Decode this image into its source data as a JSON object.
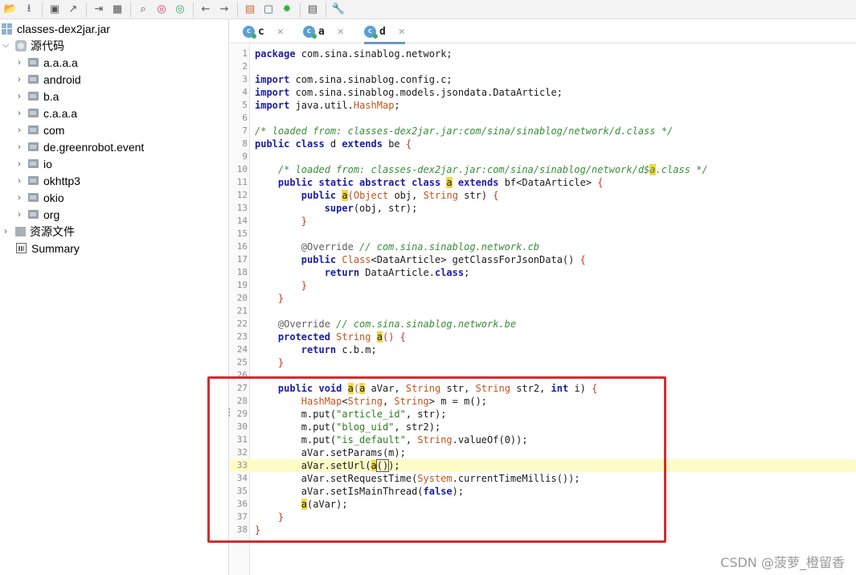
{
  "toolbar": {
    "icons": [
      "open-folder-icon",
      "export-icon",
      "save-icon",
      "external-link-icon",
      "step-icon",
      "decompile-icon",
      "search-icon",
      "find-class-icon",
      "find-usage-icon",
      "back-arrow-icon",
      "forward-arrow-icon",
      "deobfuscate-icon",
      "bookmark-icon",
      "bug-icon",
      "log-icon",
      "settings-wrench-icon"
    ]
  },
  "tree": {
    "root": "classes-dex2jar.jar",
    "source_label": "源代码",
    "packages": [
      "a.a.a.a",
      "android",
      "b.a",
      "c.a.a.a",
      "com",
      "de.greenrobot.event",
      "io",
      "okhttp3",
      "okio",
      "org"
    ],
    "resources_label": "资源文件",
    "summary_label": "Summary"
  },
  "tabs": [
    {
      "icon_letter": "c",
      "label": "c"
    },
    {
      "icon_letter": "c",
      "label": "a"
    },
    {
      "icon_letter": "c",
      "label": "d"
    }
  ],
  "editor": {
    "line_numbers": [
      "1",
      "2",
      "3",
      "4",
      "5",
      "6",
      "7",
      "8",
      "9",
      "10",
      "11",
      "12",
      "13",
      "14",
      "15",
      "16",
      "17",
      "18",
      "19",
      "20",
      "21",
      "22",
      "23",
      "24",
      "25",
      "26",
      "27",
      "28",
      "29",
      "30",
      "31",
      "32",
      "33",
      "34",
      "35",
      "36",
      "37",
      "38"
    ],
    "code": {
      "l1a": "package",
      "l1b": " com.sina.sinablog.network;",
      "l3a": "import",
      "l3b": " com.sina.sinablog.config.c;",
      "l4a": "import",
      "l4b": " com.sina.sinablog.models.jsondata.DataArticle;",
      "l5a": "import",
      "l5b": " java.util.",
      "l5c": "HashMap",
      "l5d": ";",
      "l7": "/* loaded from: classes-dex2jar.jar:com/sina/sinablog/network/d.class */",
      "l8a": "public class",
      "l8b": " d ",
      "l8c": "extends",
      "l8d": " be ",
      "l8e": "{",
      "l10a": "    /* loaded from: classes-dex2jar.jar:com/sina/sinablog/network/d$",
      "l10b": "a",
      "l10c": ".class */",
      "l11a": "    public static abstract class",
      "l11b": " ",
      "l11c": "a",
      "l11d": " ",
      "l11e": "extends",
      "l11f": " bf<DataArticle> ",
      "l11g": "{",
      "l12a": "        public",
      "l12b": " ",
      "l12c": "a",
      "l12d": "(",
      "l12e": "Object",
      "l12f": " obj, ",
      "l12g": "String",
      "l12h": " str) ",
      "l12i": "{",
      "l13a": "            super",
      "l13b": "(obj, str);",
      "l14": "        }",
      "l16a": "        @Override",
      "l16b": " // com.sina.sinablog.network.cb",
      "l17a": "        public",
      "l17b": " ",
      "l17c": "Class",
      "l17d": "<DataArticle> getClassForJsonData() ",
      "l17e": "{",
      "l18a": "            return",
      "l18b": " DataArticle.",
      "l18c": "class",
      "l18d": ";",
      "l19": "        }",
      "l20": "    }",
      "l22a": "    @Override",
      "l22b": " // com.sina.sinablog.network.be",
      "l23a": "    protected",
      "l23b": " ",
      "l23c": "String",
      "l23d": " ",
      "l23e": "a",
      "l23f": "() ",
      "l23g": "{",
      "l24a": "        return",
      "l24b": " c.b.m;",
      "l25": "    }",
      "l27a": "    public void",
      "l27b": " ",
      "l27c": "a",
      "l27d": "(",
      "l27e": "a",
      "l27f": " aVar, ",
      "l27g": "String",
      "l27h": " str, ",
      "l27i": "String",
      "l27j": " str2, ",
      "l27k": "int",
      "l27l": " i) ",
      "l27m": "{",
      "l28a": "        ",
      "l28b": "HashMap",
      "l28c": "<",
      "l28d": "String",
      "l28e": ", ",
      "l28f": "String",
      "l28g": "> m = m();",
      "l29a": "        m.put(",
      "l29b": "\"article_id\"",
      "l29c": ", str);",
      "l30a": "        m.put(",
      "l30b": "\"blog_uid\"",
      "l30c": ", str2);",
      "l31a": "        m.put(",
      "l31b": "\"is_default\"",
      "l31c": ", ",
      "l31d": "String",
      "l31e": ".valueOf(0));",
      "l32": "        aVar.setParams(m);",
      "l33a": "        aVar.setUrl(",
      "l33b": "a",
      "l33c": "()",
      "l33d": ");",
      "l34a": "        aVar.setRequestTime(",
      "l34b": "System",
      "l34c": ".currentTimeMillis());",
      "l35a": "        aVar.setIsMainThread(",
      "l35b": "false",
      "l35c": ");",
      "l36a": "        ",
      "l36b": "a",
      "l36c": "(aVar);",
      "l37": "    }",
      "l38": "}"
    }
  },
  "watermark": "CSDN @菠萝_橙留香",
  "colors": {
    "highlight_line": "#fefcc6",
    "annotation_box": "#d42b2b",
    "tab_underline": "#6f96c8"
  }
}
